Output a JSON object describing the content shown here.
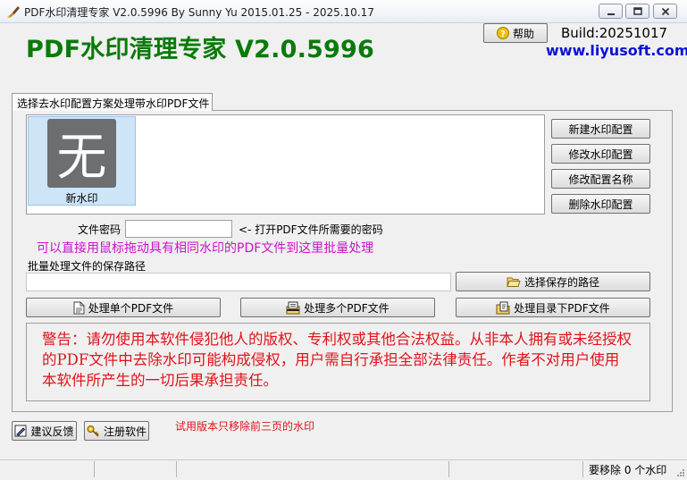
{
  "window": {
    "title": "PDF水印清理专家 V2.0.5996 By Sunny Yu 2015.01.25 - 2025.10.17"
  },
  "header": {
    "app_heading": "PDF水印清理专家 V2.0.5996",
    "help_label": "帮助",
    "build": "Build:20251017",
    "website": "www.liyusoft.com"
  },
  "tab": {
    "label": "选择去水印配置方案处理带水印PDF文件"
  },
  "profile": {
    "icon_glyph": "无",
    "label": "新水印"
  },
  "side_buttons": {
    "new_config": "新建水印配置",
    "edit_config": "修改水印配置",
    "rename_config": "修改配置名称",
    "delete_config": "删除水印配置"
  },
  "password": {
    "label": "文件密码",
    "value": "",
    "hint": "<- 打开PDF文件所需要的密码"
  },
  "drag_hint": "可以直接用鼠标拖动具有相同水印的PDF文件到这里批量处理",
  "save_path": {
    "label": "批量处理文件的保存路径",
    "value": "",
    "choose_label": "选择保存的路径"
  },
  "actions": {
    "single": "处理单个PDF文件",
    "multi": "处理多个PDF文件",
    "directory": "处理目录下PDF文件"
  },
  "warning": "警告：请勿使用本软件侵犯他人的版权、专利权或其他合法权益。从非本人拥有或未经授权的PDF文件中去除水印可能构成侵权，用户需自行承担全部法律责任。作者不对用户使用本软件所产生的一切后果承担责任。",
  "footer": {
    "feedback": "建议反馈",
    "register": "注册软件",
    "trial_note": "试用版本只移除前三页的水印"
  },
  "statusbar": {
    "text": "要移除 0 个水印"
  },
  "colors": {
    "heading": "#0a7a0a",
    "website": "#0a12d8",
    "drag_hint": "#c815c8",
    "warning": "#e0141b"
  }
}
